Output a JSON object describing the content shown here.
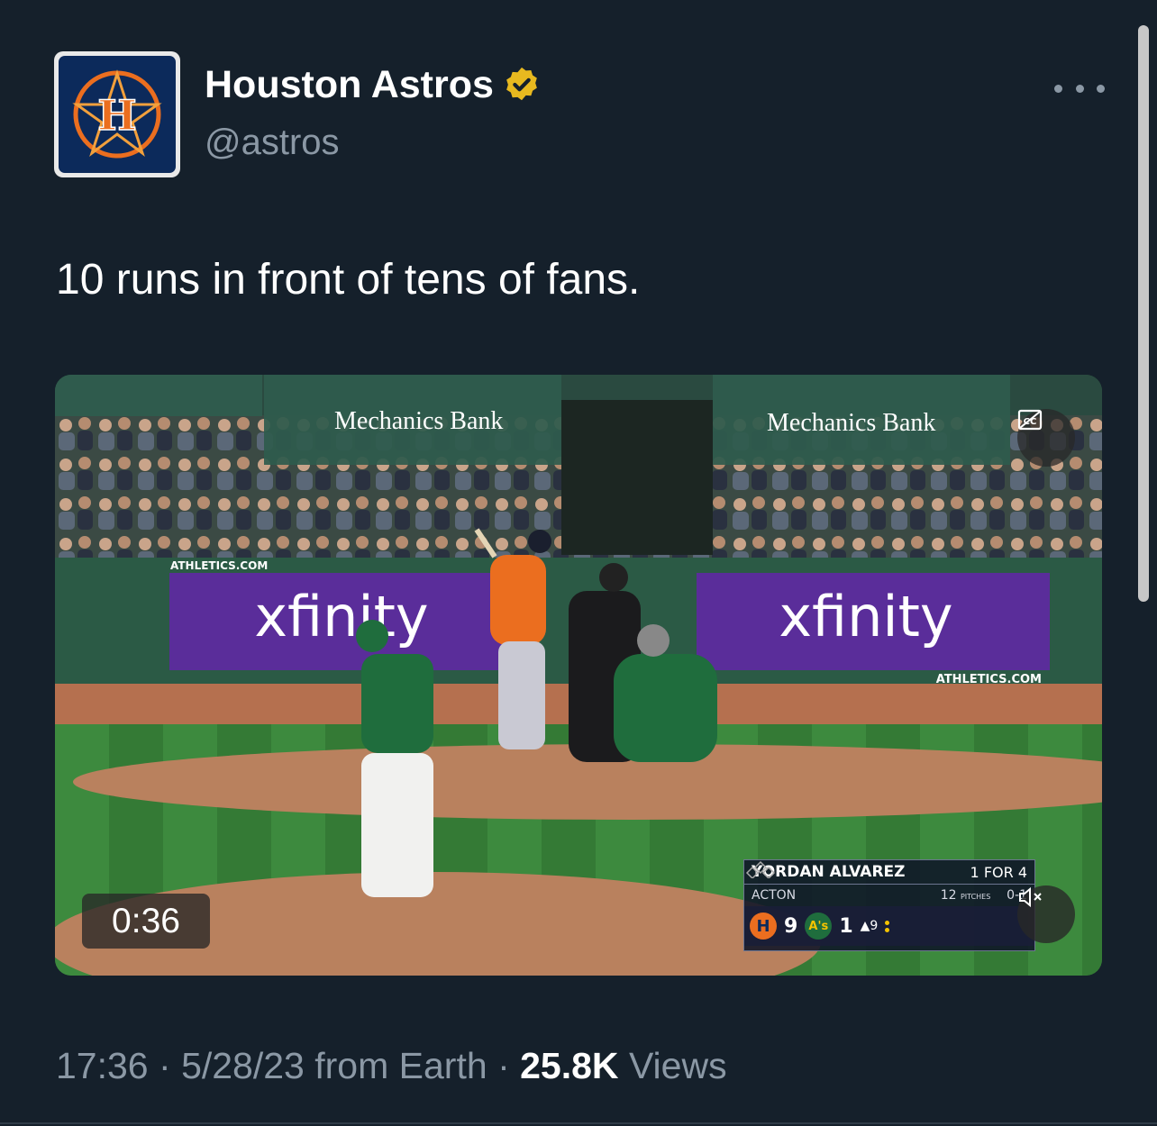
{
  "author": {
    "display_name": "Houston Astros",
    "handle": "@astros"
  },
  "tweet": {
    "text": "10 runs in front of tens of fans."
  },
  "video": {
    "duration": "0:36",
    "scene": {
      "banner_sponsor": "Mechanics Bank",
      "ad_board": "xfinity",
      "ad_board_url": "ATHLETICS.COM",
      "dugout_url": "ATHLETICS.COM"
    },
    "scorebug": {
      "batter": "YORDAN ALVAREZ",
      "batter_stat": "1 FOR 4",
      "pitcher": "ACTON",
      "pitches": "12",
      "pitches_label": "PITCHES",
      "count": "0-1",
      "home_logo": "H",
      "home_score": "9",
      "away_logo": "A's",
      "away_score": "1",
      "inning": "9"
    }
  },
  "meta": {
    "time": "17:36",
    "date": "5/28/23",
    "source": "from Earth",
    "views_count": "25.8K",
    "views_label": "Views"
  },
  "colors": {
    "background": "#15202b",
    "secondary_text": "#8b98a5",
    "verified_badge": "#e8b91f",
    "astros_orange": "#eb6e1f",
    "astros_navy": "#0c2a5b"
  }
}
